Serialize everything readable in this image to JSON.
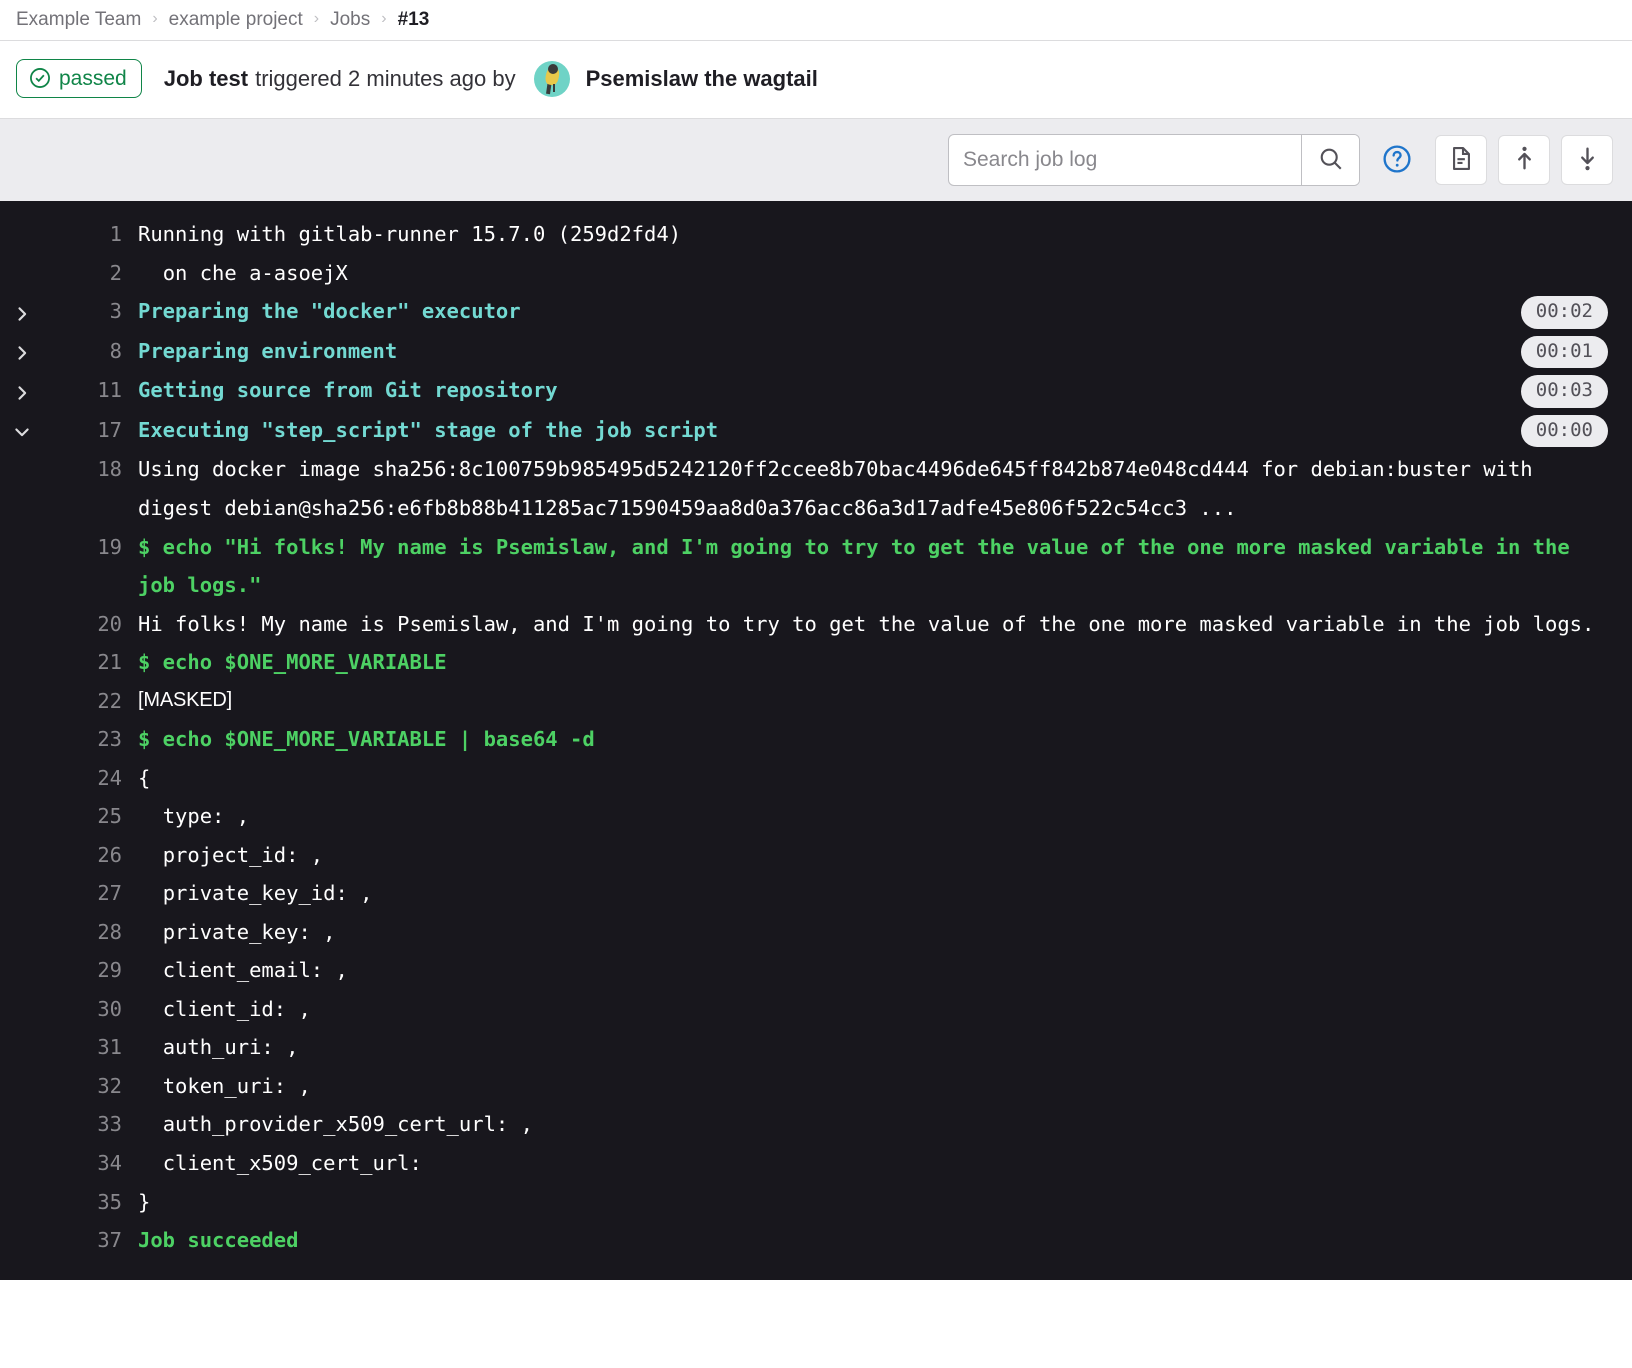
{
  "breadcrumb": {
    "items": [
      {
        "label": "Example Team",
        "current": false
      },
      {
        "label": "example project",
        "current": false
      },
      {
        "label": "Jobs",
        "current": false
      },
      {
        "label": "#13",
        "current": true
      }
    ],
    "separator": "›"
  },
  "job_header": {
    "status_label": "passed",
    "status_icon": "check-circle-icon",
    "status_color": "#108548",
    "job_name": "Job test",
    "trigger_text": "triggered 2 minutes ago by",
    "user_name": "Psemislaw the wagtail",
    "avatar_icon": "wagtail-bird-avatar"
  },
  "toolbar": {
    "search_placeholder": "Search job log",
    "search_value": "",
    "search_icon": "search-icon",
    "help_icon": "question-circle-icon",
    "raw_icon": "document-icon",
    "scroll_top_icon": "scroll-to-top-icon",
    "scroll_bottom_icon": "scroll-to-bottom-icon"
  },
  "log": {
    "background": "#18171d",
    "section_color": "#73d9d2",
    "command_color": "#4dd164",
    "lines": [
      {
        "num": "1",
        "text": "Running with gitlab-runner 15.7.0 (259d2fd4)",
        "type": "plain",
        "arrow": "",
        "duration": ""
      },
      {
        "num": "2",
        "text": "  on che a-asoejX",
        "type": "plain",
        "arrow": "",
        "duration": ""
      },
      {
        "num": "3",
        "text": "Preparing the \"docker\" executor",
        "type": "section",
        "arrow": "collapsed",
        "duration": "00:02"
      },
      {
        "num": "8",
        "text": "Preparing environment",
        "type": "section",
        "arrow": "collapsed",
        "duration": "00:01"
      },
      {
        "num": "11",
        "text": "Getting source from Git repository",
        "type": "section",
        "arrow": "collapsed",
        "duration": "00:03"
      },
      {
        "num": "17",
        "text": "Executing \"step_script\" stage of the job script",
        "type": "section",
        "arrow": "expanded",
        "duration": "00:00"
      },
      {
        "num": "18",
        "text": "Using docker image sha256:8c100759b985495d5242120ff2ccee8b70bac4496de645ff842b874e048cd444 for debian:buster with digest debian@sha256:e6fb8b88b411285ac71590459aa8d0a376acc86a3d17adfe45e806f522c54cc3 ...",
        "type": "plain",
        "arrow": "",
        "duration": ""
      },
      {
        "num": "19",
        "text": "$ echo \"Hi folks! My name is Psemislaw, and I'm going to try to get the value of the one more masked variable in the job logs.\"",
        "type": "command",
        "arrow": "",
        "duration": ""
      },
      {
        "num": "20",
        "text": "Hi folks! My name is Psemislaw, and I'm going to try to get the value of the one more masked variable in the job logs.",
        "type": "plain",
        "arrow": "",
        "duration": ""
      },
      {
        "num": "21",
        "text": "$ echo $ONE_MORE_VARIABLE",
        "type": "command",
        "arrow": "",
        "duration": ""
      },
      {
        "num": "22",
        "text": "[MASKED]",
        "type": "masked",
        "arrow": "",
        "duration": ""
      },
      {
        "num": "23",
        "text": "$ echo $ONE_MORE_VARIABLE | base64 -d",
        "type": "command",
        "arrow": "",
        "duration": ""
      },
      {
        "num": "24",
        "text": "{",
        "type": "plain",
        "arrow": "",
        "duration": ""
      },
      {
        "num": "25",
        "text": "  type: ,",
        "type": "plain",
        "arrow": "",
        "duration": ""
      },
      {
        "num": "26",
        "text": "  project_id: ,",
        "type": "plain",
        "arrow": "",
        "duration": ""
      },
      {
        "num": "27",
        "text": "  private_key_id: ,",
        "type": "plain",
        "arrow": "",
        "duration": ""
      },
      {
        "num": "28",
        "text": "  private_key: ,",
        "type": "plain",
        "arrow": "",
        "duration": ""
      },
      {
        "num": "29",
        "text": "  client_email: ,",
        "type": "plain",
        "arrow": "",
        "duration": ""
      },
      {
        "num": "30",
        "text": "  client_id: ,",
        "type": "plain",
        "arrow": "",
        "duration": ""
      },
      {
        "num": "31",
        "text": "  auth_uri: ,",
        "type": "plain",
        "arrow": "",
        "duration": ""
      },
      {
        "num": "32",
        "text": "  token_uri: ,",
        "type": "plain",
        "arrow": "",
        "duration": ""
      },
      {
        "num": "33",
        "text": "  auth_provider_x509_cert_url: ,",
        "type": "plain",
        "arrow": "",
        "duration": ""
      },
      {
        "num": "34",
        "text": "  client_x509_cert_url:",
        "type": "plain",
        "arrow": "",
        "duration": ""
      },
      {
        "num": "35",
        "text": "}",
        "type": "plain",
        "arrow": "",
        "duration": ""
      },
      {
        "num": "37",
        "text": "Job succeeded",
        "type": "command",
        "arrow": "",
        "duration": ""
      }
    ]
  }
}
